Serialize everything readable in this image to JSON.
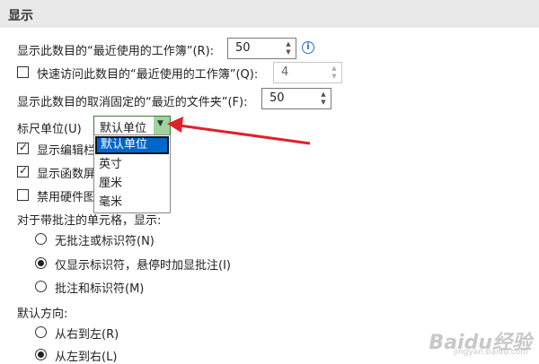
{
  "section": {
    "title": "显示"
  },
  "recent_workbooks": {
    "label": "显示此数目的“最近使用的工作簿”(R):",
    "value": "50"
  },
  "quick_access": {
    "label": "快速访问此数目的“最近使用的工作簿”(Q):",
    "value": "4",
    "checked": false
  },
  "recent_folders": {
    "label": "显示此数目的取消固定的“最近的文件夹”(F):",
    "value": "50"
  },
  "ruler_units": {
    "label": "标尺单位(U)",
    "selected": "默认单位",
    "options": [
      "默认单位",
      "英寸",
      "厘米",
      "毫米"
    ]
  },
  "checkboxes": [
    {
      "label": "显示编辑栏",
      "checked": true
    },
    {
      "label": "显示函数屏",
      "checked": true
    },
    {
      "label": "禁用硬件图",
      "checked": false
    }
  ],
  "comments": {
    "heading": "对于带批注的单元格，显示:",
    "options": [
      {
        "label": "无批注或标识符(N)",
        "selected": false
      },
      {
        "label": "仅显示标识符，悬停时加显批注(I)",
        "selected": true
      },
      {
        "label": "批注和标识符(M)",
        "selected": false
      }
    ]
  },
  "direction": {
    "heading": "默认方向:",
    "options": [
      {
        "label": "从右到左(R)",
        "selected": false
      },
      {
        "label": "从左到右(L)",
        "selected": true
      }
    ]
  },
  "watermark": {
    "text": "Baidu经验",
    "sub": "jingyan.baidu.com"
  },
  "colors": {
    "accent": "#0066cc",
    "arrow": "#e0202a",
    "dropdown_button": "#9fd49f",
    "header_bg": "#e9e9e9"
  }
}
